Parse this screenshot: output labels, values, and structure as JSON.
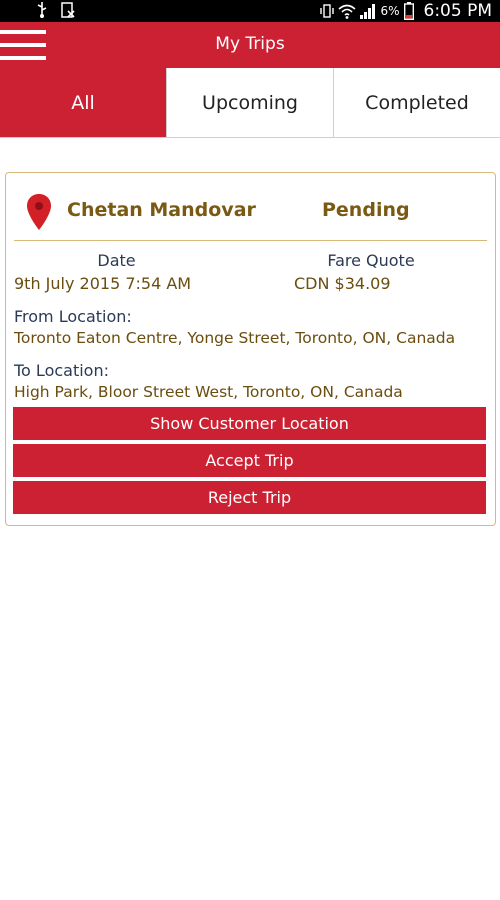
{
  "status_bar": {
    "icons": [
      "usb-icon",
      "no-sim-icon",
      "vibrate-icon",
      "wifi-icon",
      "signal-icon",
      "battery-icon"
    ],
    "battery": "6%",
    "time": "6:05 PM"
  },
  "app_bar": {
    "title": "My Trips",
    "menu_icon": "hamburger-menu-icon",
    "color": "#cc2133"
  },
  "tabs": [
    {
      "label": "All",
      "active": true
    },
    {
      "label": "Upcoming",
      "active": false
    },
    {
      "label": "Completed",
      "active": false
    }
  ],
  "trip": {
    "customer_name": "Chetan Mandovar",
    "status": "Pending",
    "date_label": "Date",
    "date_value": "9th July 2015 7:54 AM",
    "fare_label": "Fare Quote",
    "fare_value": "CDN $34.09",
    "from_label": "From Location:",
    "from_value": "Toronto Eaton Centre, Yonge Street, Toronto, ON, Canada",
    "to_label": "To Location:",
    "to_value": "High Park, Bloor Street West, Toronto, ON, Canada",
    "buttons": {
      "show_location": "Show Customer Location",
      "accept": "Accept Trip",
      "reject": "Reject Trip"
    }
  }
}
